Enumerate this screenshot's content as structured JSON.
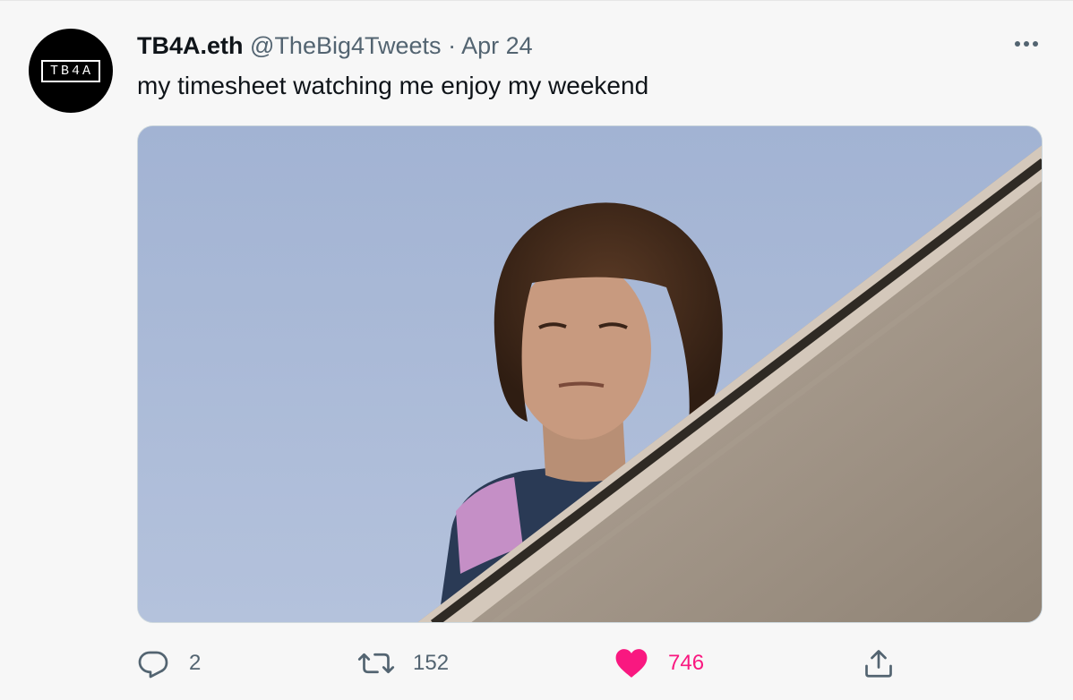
{
  "tweet": {
    "avatar_text": "TB4A",
    "display_name": "TB4A.eth",
    "handle": "@TheBig4Tweets",
    "separator": "·",
    "date": "Apr 24",
    "text": "my timesheet watching me enjoy my weekend",
    "media_alt": "photo: person with bob haircut peering over a rooftop ledge against blue sky"
  },
  "actions": {
    "reply_count": "2",
    "retweet_count": "152",
    "like_count": "746",
    "liked": true
  },
  "colors": {
    "text_primary": "#0f1419",
    "text_secondary": "#536471",
    "like": "#f91880",
    "sky": "#a6b6d4"
  },
  "icons": [
    "more-icon",
    "reply-icon",
    "retweet-icon",
    "heart-icon",
    "share-icon"
  ]
}
